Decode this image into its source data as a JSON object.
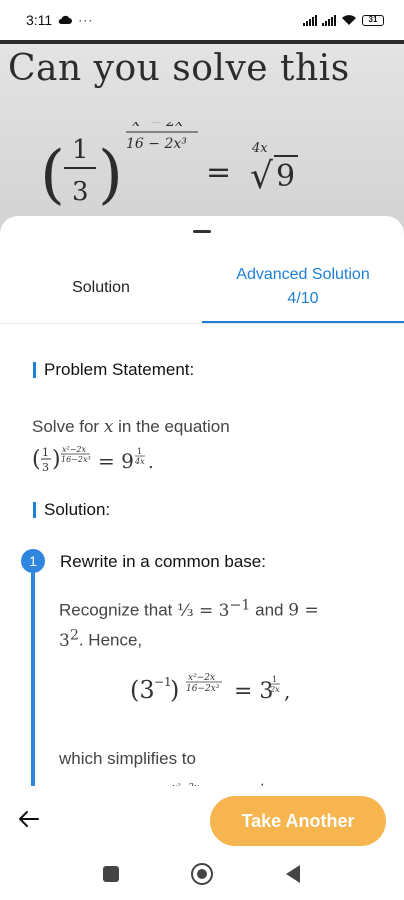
{
  "status": {
    "time": "3:11",
    "icons": [
      "cloud-icon",
      "more-icon"
    ],
    "right_icons": [
      "signal-icon",
      "signal-icon",
      "wifi-icon"
    ],
    "battery": "31"
  },
  "photo": {
    "text": "Can you solve this",
    "equation": {
      "base_num": "1",
      "base_den": "3",
      "exp_num": "x² − 2x",
      "exp_den": "16 − 2x³",
      "equals": "=",
      "root_index": "4x",
      "radical": "√",
      "radicand": "9"
    }
  },
  "tabs": [
    {
      "label": "Solution"
    },
    {
      "label": "Advanced Solution",
      "sub": "4/10"
    }
  ],
  "problem": {
    "title": "Problem Statement:",
    "intro": "Solve for",
    "var": "x",
    "intro_tail": "in the equation"
  },
  "solution": {
    "title": "Solution:",
    "step_number": "1",
    "step_title": "Rewrite in a common base:",
    "line1": "Recognize that",
    "and": "and",
    "hence": ". Hence,",
    "simplifies": "which simplifies to"
  },
  "actions": {
    "take_another": "Take Another"
  },
  "colors": {
    "accent": "#1e7fd6",
    "button": "#f6b54e"
  }
}
